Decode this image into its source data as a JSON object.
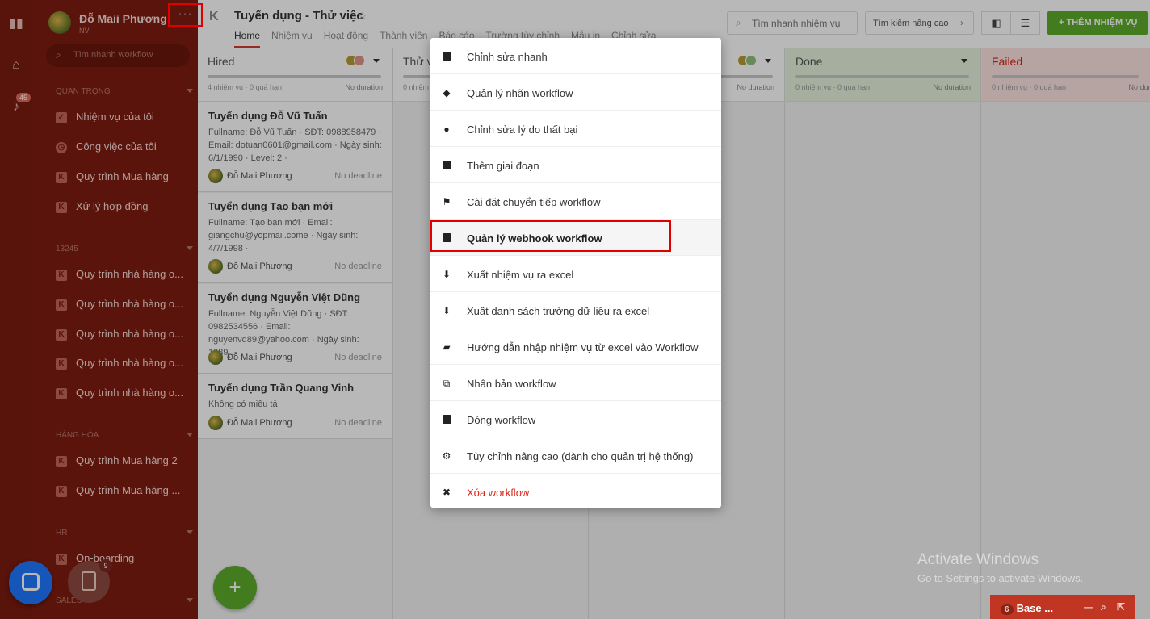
{
  "sidebar": {
    "profile_name": "Đỗ Maii Phương",
    "profile_role": "NV",
    "search_placeholder": "Tìm nhanh workflow",
    "notification_count": "45",
    "sections": {
      "important": "QUAN TRỌNG",
      "s13245": "13245",
      "goods": "HÀNG HÓA",
      "hr": "HR",
      "sales": "SALES"
    },
    "items": [
      {
        "label": "Nhiệm vụ của tôi",
        "icon": "check-icon"
      },
      {
        "label": "Công việc của tôi",
        "icon": "clock-icon"
      },
      {
        "label": "Quy trình Mua hàng",
        "icon": "workflow-icon"
      },
      {
        "label": "Xử lý hợp đồng",
        "icon": "workflow-icon"
      },
      {
        "label": "Quy trình nhà hàng o...",
        "icon": "workflow-icon"
      },
      {
        "label": "Quy trình nhà hàng o...",
        "icon": "workflow-icon"
      },
      {
        "label": "Quy trình nhà hàng o...",
        "icon": "workflow-icon"
      },
      {
        "label": "Quy trình nhà hàng o...",
        "icon": "workflow-icon"
      },
      {
        "label": "Quy trình nhà hàng o...",
        "icon": "workflow-icon"
      },
      {
        "label": "Quy trình Mua hàng 2",
        "icon": "workflow-icon"
      },
      {
        "label": "Quy trình Mua hàng ...",
        "icon": "workflow-icon"
      },
      {
        "label": "On-boarding",
        "icon": "workflow-icon"
      }
    ],
    "clip_badge": "9"
  },
  "header": {
    "title": "Tuyển dụng - Thử việc",
    "more": "···",
    "tabs": [
      "Home",
      "Nhiệm vụ",
      "Hoạt động",
      "Thành viên",
      "Báo cáo",
      "Trường tùy chỉnh",
      "Mẫu in",
      "Chỉnh sửa"
    ],
    "search_placeholder": "Tìm nhanh nhiệm vụ",
    "advanced_search": "Tìm kiếm nâng cao",
    "add_task": "+ THÊM NHIỆM VỤ"
  },
  "columns": [
    {
      "name": "Hired",
      "meta": "4 nhiệm vụ · 0 quá hạn",
      "duration": "No duration"
    },
    {
      "name": "Thử việc",
      "meta": "0 nhiệm vụ · 0 quá hạn",
      "duration": "No duration"
    },
    {
      "name": "",
      "meta": "",
      "duration": "No duration"
    },
    {
      "name": "Done",
      "meta": "0 nhiệm vụ · 0 quá hạn",
      "duration": "No duration"
    },
    {
      "name": "Failed",
      "meta": "0 nhiệm vụ · 0 quá hạn",
      "duration": "No duration"
    }
  ],
  "cards": [
    {
      "title": "Tuyển dụng Đỗ Vũ Tuấn",
      "desc": "Fullname: Đỗ Vũ Tuấn · SĐT: 0988958479 · Email: dotuan0601@gmail.com · Ngày sinh: 6/1/1990 · Level: 2 ·",
      "user": "Đỗ Maii Phương",
      "deadline": "No deadline"
    },
    {
      "title": "Tuyển dụng Tạo bạn mới",
      "desc": "Fullname: Tạo bạn mới · Email: giangchu@yopmail.come · Ngày sinh: 4/7/1998 ·",
      "user": "Đỗ Maii Phương",
      "deadline": "No deadline"
    },
    {
      "title": "Tuyển dụng Nguyễn Việt Dũng",
      "desc": "Fullname: Nguyễn Việt Dũng · SĐT: 0982534556 · Email: nguyenvd89@yahoo.com · Ngày sinh: 1989...",
      "user": "Đỗ Maii Phương",
      "deadline": "No deadline"
    },
    {
      "title": "Tuyển dụng Trần Quang Vinh",
      "desc": "Không có miêu tả",
      "user": "Đỗ Maii Phương",
      "deadline": "No deadline"
    }
  ],
  "menu": [
    {
      "label": "Chỉnh sửa nhanh",
      "icon": "edit-icon"
    },
    {
      "label": "Quản lý nhãn workflow",
      "icon": "tags-icon"
    },
    {
      "label": "Chỉnh sửa lý do thất bại",
      "icon": "info-icon"
    },
    {
      "label": "Thêm giai đoạn",
      "icon": "edit-icon"
    },
    {
      "label": "Cài đặt chuyển tiếp workflow",
      "icon": "flag-icon"
    },
    {
      "label": "Quản lý webhook workflow",
      "icon": "webhook-icon"
    },
    {
      "label": "Xuất nhiệm vụ ra excel",
      "icon": "download-icon"
    },
    {
      "label": "Xuất danh sách trường dữ liệu ra excel",
      "icon": "download-icon"
    },
    {
      "label": "Hướng dẫn nhập nhiệm vụ từ excel vào Workflow",
      "icon": "book-icon"
    },
    {
      "label": "Nhân bản workflow",
      "icon": "clone-icon"
    },
    {
      "label": "Đóng workflow",
      "icon": "minus-icon"
    },
    {
      "label": "Tùy chỉnh nâng cao (dành cho quản trị hệ thống)",
      "icon": "gear-icon"
    },
    {
      "label": "Xóa workflow",
      "icon": "delete-icon"
    }
  ],
  "watermark": {
    "line1": "Activate Windows",
    "line2": "Go to Settings to activate Windows."
  },
  "chat": {
    "count": "6",
    "label": "Base ..."
  },
  "colors": {
    "brand_red": "#7f1d10",
    "accent_green": "#5cac2c",
    "highlight_red": "#e00000"
  }
}
